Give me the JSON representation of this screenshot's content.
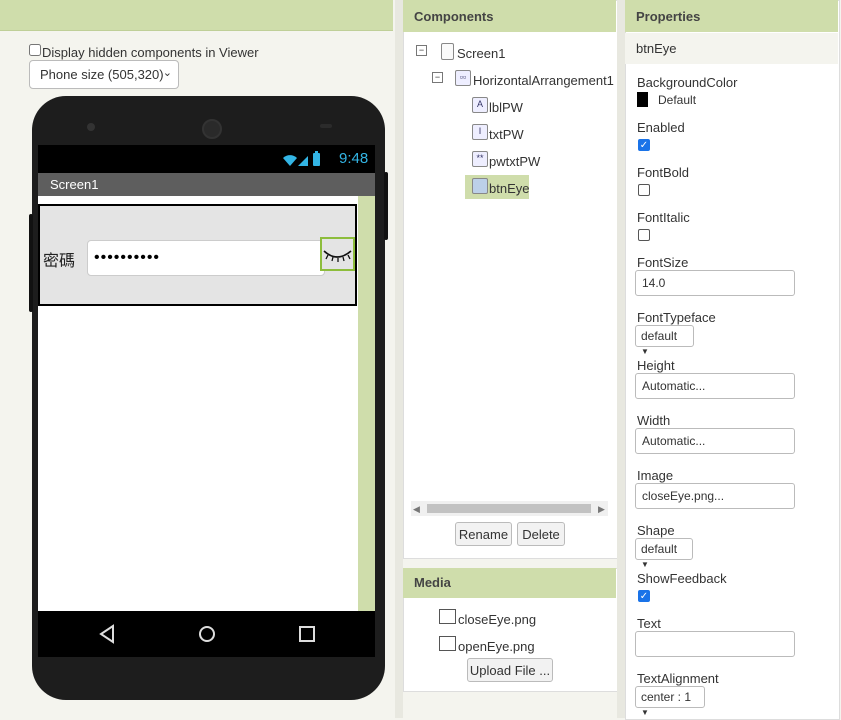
{
  "viewer": {
    "hidden_label": "Display hidden components in Viewer",
    "phone_size": "Phone size (505,320)",
    "status_time": "9:48",
    "screen_title": "Screen1",
    "label_pw": "密碼",
    "password_value": "••••••••••"
  },
  "components": {
    "title": "Components",
    "tree": {
      "screen": "Screen1",
      "harrangement": "HorizontalArrangement1",
      "lbl": "lblPW",
      "txt": "txtPW",
      "pwtxt": "pwtxtPW",
      "btn": "btnEye"
    },
    "rename_label": "Rename",
    "delete_label": "Delete"
  },
  "media": {
    "title": "Media",
    "files": [
      "closeEye.png",
      "openEye.png"
    ],
    "upload_label": "Upload File ..."
  },
  "properties": {
    "title": "Properties",
    "selected": "btnEye",
    "background_color_label": "BackgroundColor",
    "background_color_value": "Default",
    "enabled_label": "Enabled",
    "fontbold_label": "FontBold",
    "fontitalic_label": "FontItalic",
    "fontsize_label": "FontSize",
    "fontsize_value": "14.0",
    "fonttypeface_label": "FontTypeface",
    "fonttypeface_value": "default",
    "height_label": "Height",
    "height_value": "Automatic...",
    "width_label": "Width",
    "width_value": "Automatic...",
    "image_label": "Image",
    "image_value": "closeEye.png...",
    "shape_label": "Shape",
    "shape_value": "default",
    "showfeedback_label": "ShowFeedback",
    "text_label": "Text",
    "text_value": "",
    "textalignment_label": "TextAlignment",
    "textalignment_value": "center : 1"
  },
  "colors": {
    "header": "#cfddab",
    "accent_blue": "#1a73e8",
    "status_time": "#33b5e5"
  }
}
